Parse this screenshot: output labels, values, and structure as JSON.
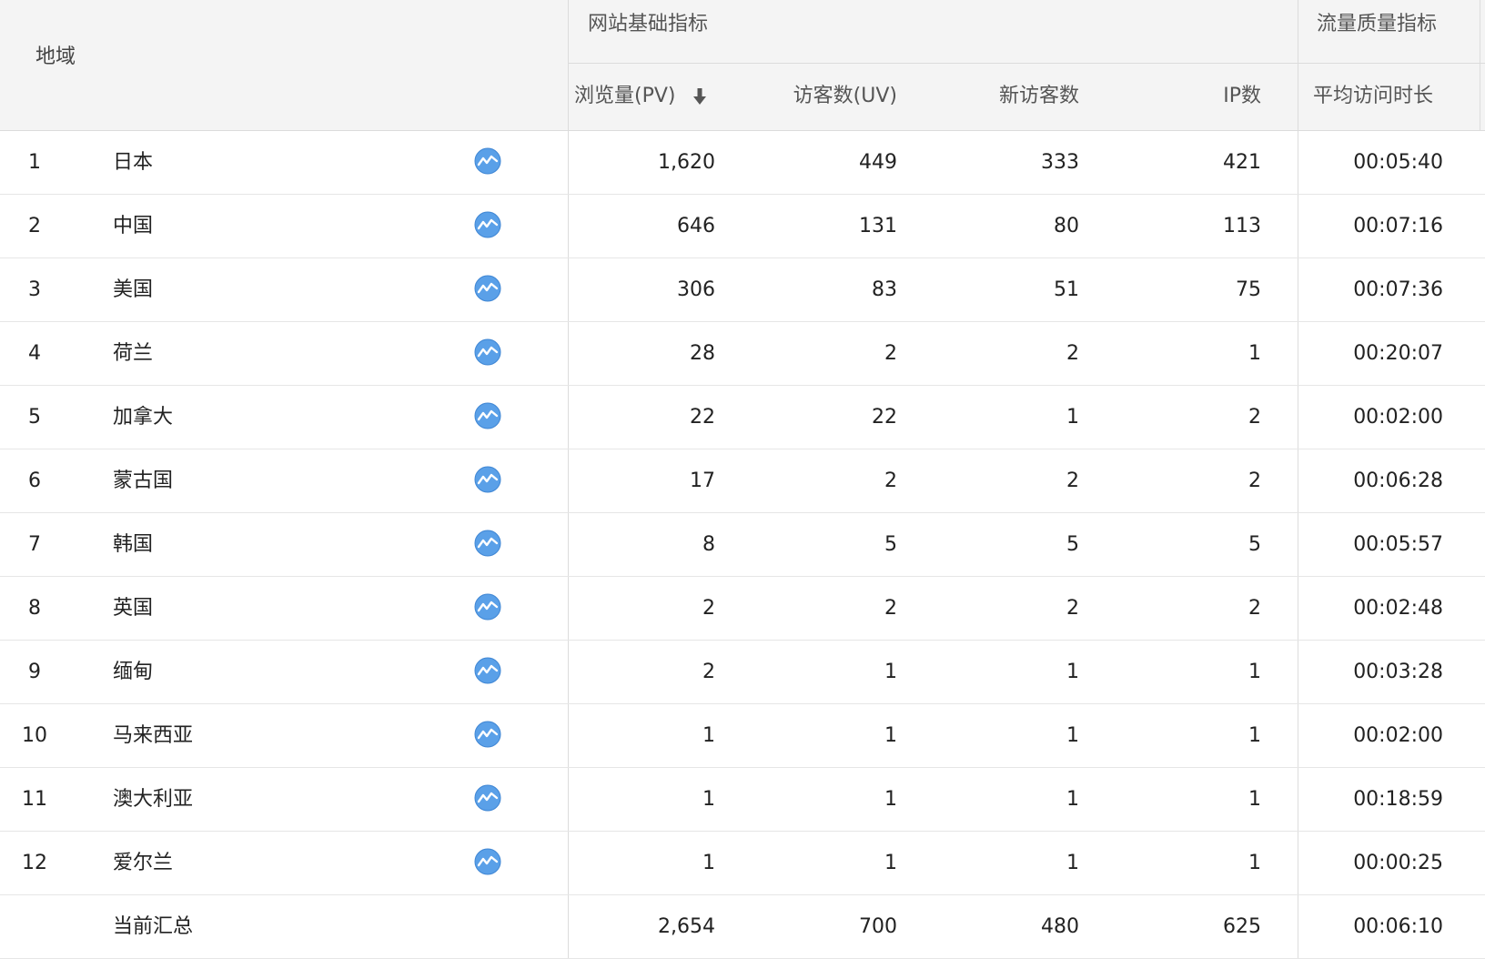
{
  "header": {
    "region_label": "地域",
    "group_basic": "网站基础指标",
    "group_quality": "流量质量指标",
    "columns": {
      "pv": "浏览量(PV)",
      "uv": "访客数(UV)",
      "new_visitors": "新访客数",
      "ip": "IP数",
      "avg_duration": "平均访问时长"
    },
    "sort_icon": "arrow-down-icon"
  },
  "rows": [
    {
      "idx": "1",
      "region": "日本",
      "pv": "1,620",
      "uv": "449",
      "nv": "333",
      "ip": "421",
      "dur": "00:05:40"
    },
    {
      "idx": "2",
      "region": "中国",
      "pv": "646",
      "uv": "131",
      "nv": "80",
      "ip": "113",
      "dur": "00:07:16"
    },
    {
      "idx": "3",
      "region": "美国",
      "pv": "306",
      "uv": "83",
      "nv": "51",
      "ip": "75",
      "dur": "00:07:36"
    },
    {
      "idx": "4",
      "region": "荷兰",
      "pv": "28",
      "uv": "2",
      "nv": "2",
      "ip": "1",
      "dur": "00:20:07"
    },
    {
      "idx": "5",
      "region": "加拿大",
      "pv": "22",
      "uv": "22",
      "nv": "1",
      "ip": "2",
      "dur": "00:02:00"
    },
    {
      "idx": "6",
      "region": "蒙古国",
      "pv": "17",
      "uv": "2",
      "nv": "2",
      "ip": "2",
      "dur": "00:06:28"
    },
    {
      "idx": "7",
      "region": "韩国",
      "pv": "8",
      "uv": "5",
      "nv": "5",
      "ip": "5",
      "dur": "00:05:57"
    },
    {
      "idx": "8",
      "region": "英国",
      "pv": "2",
      "uv": "2",
      "nv": "2",
      "ip": "2",
      "dur": "00:02:48"
    },
    {
      "idx": "9",
      "region": "缅甸",
      "pv": "2",
      "uv": "1",
      "nv": "1",
      "ip": "1",
      "dur": "00:03:28"
    },
    {
      "idx": "10",
      "region": "马来西亚",
      "pv": "1",
      "uv": "1",
      "nv": "1",
      "ip": "1",
      "dur": "00:02:00"
    },
    {
      "idx": "11",
      "region": "澳大利亚",
      "pv": "1",
      "uv": "1",
      "nv": "1",
      "ip": "1",
      "dur": "00:18:59"
    },
    {
      "idx": "12",
      "region": "爱尔兰",
      "pv": "1",
      "uv": "1",
      "nv": "1",
      "ip": "1",
      "dur": "00:00:25"
    }
  ],
  "summary": {
    "label": "当前汇总",
    "pv": "2,654",
    "uv": "700",
    "nv": "480",
    "ip": "625",
    "dur": "00:06:10"
  },
  "trend_icon": "trend-chart-icon",
  "colors": {
    "header_bg": "#f4f4f4",
    "grid": "#dcdcdc",
    "trend_blue": "#5aa0e8"
  }
}
